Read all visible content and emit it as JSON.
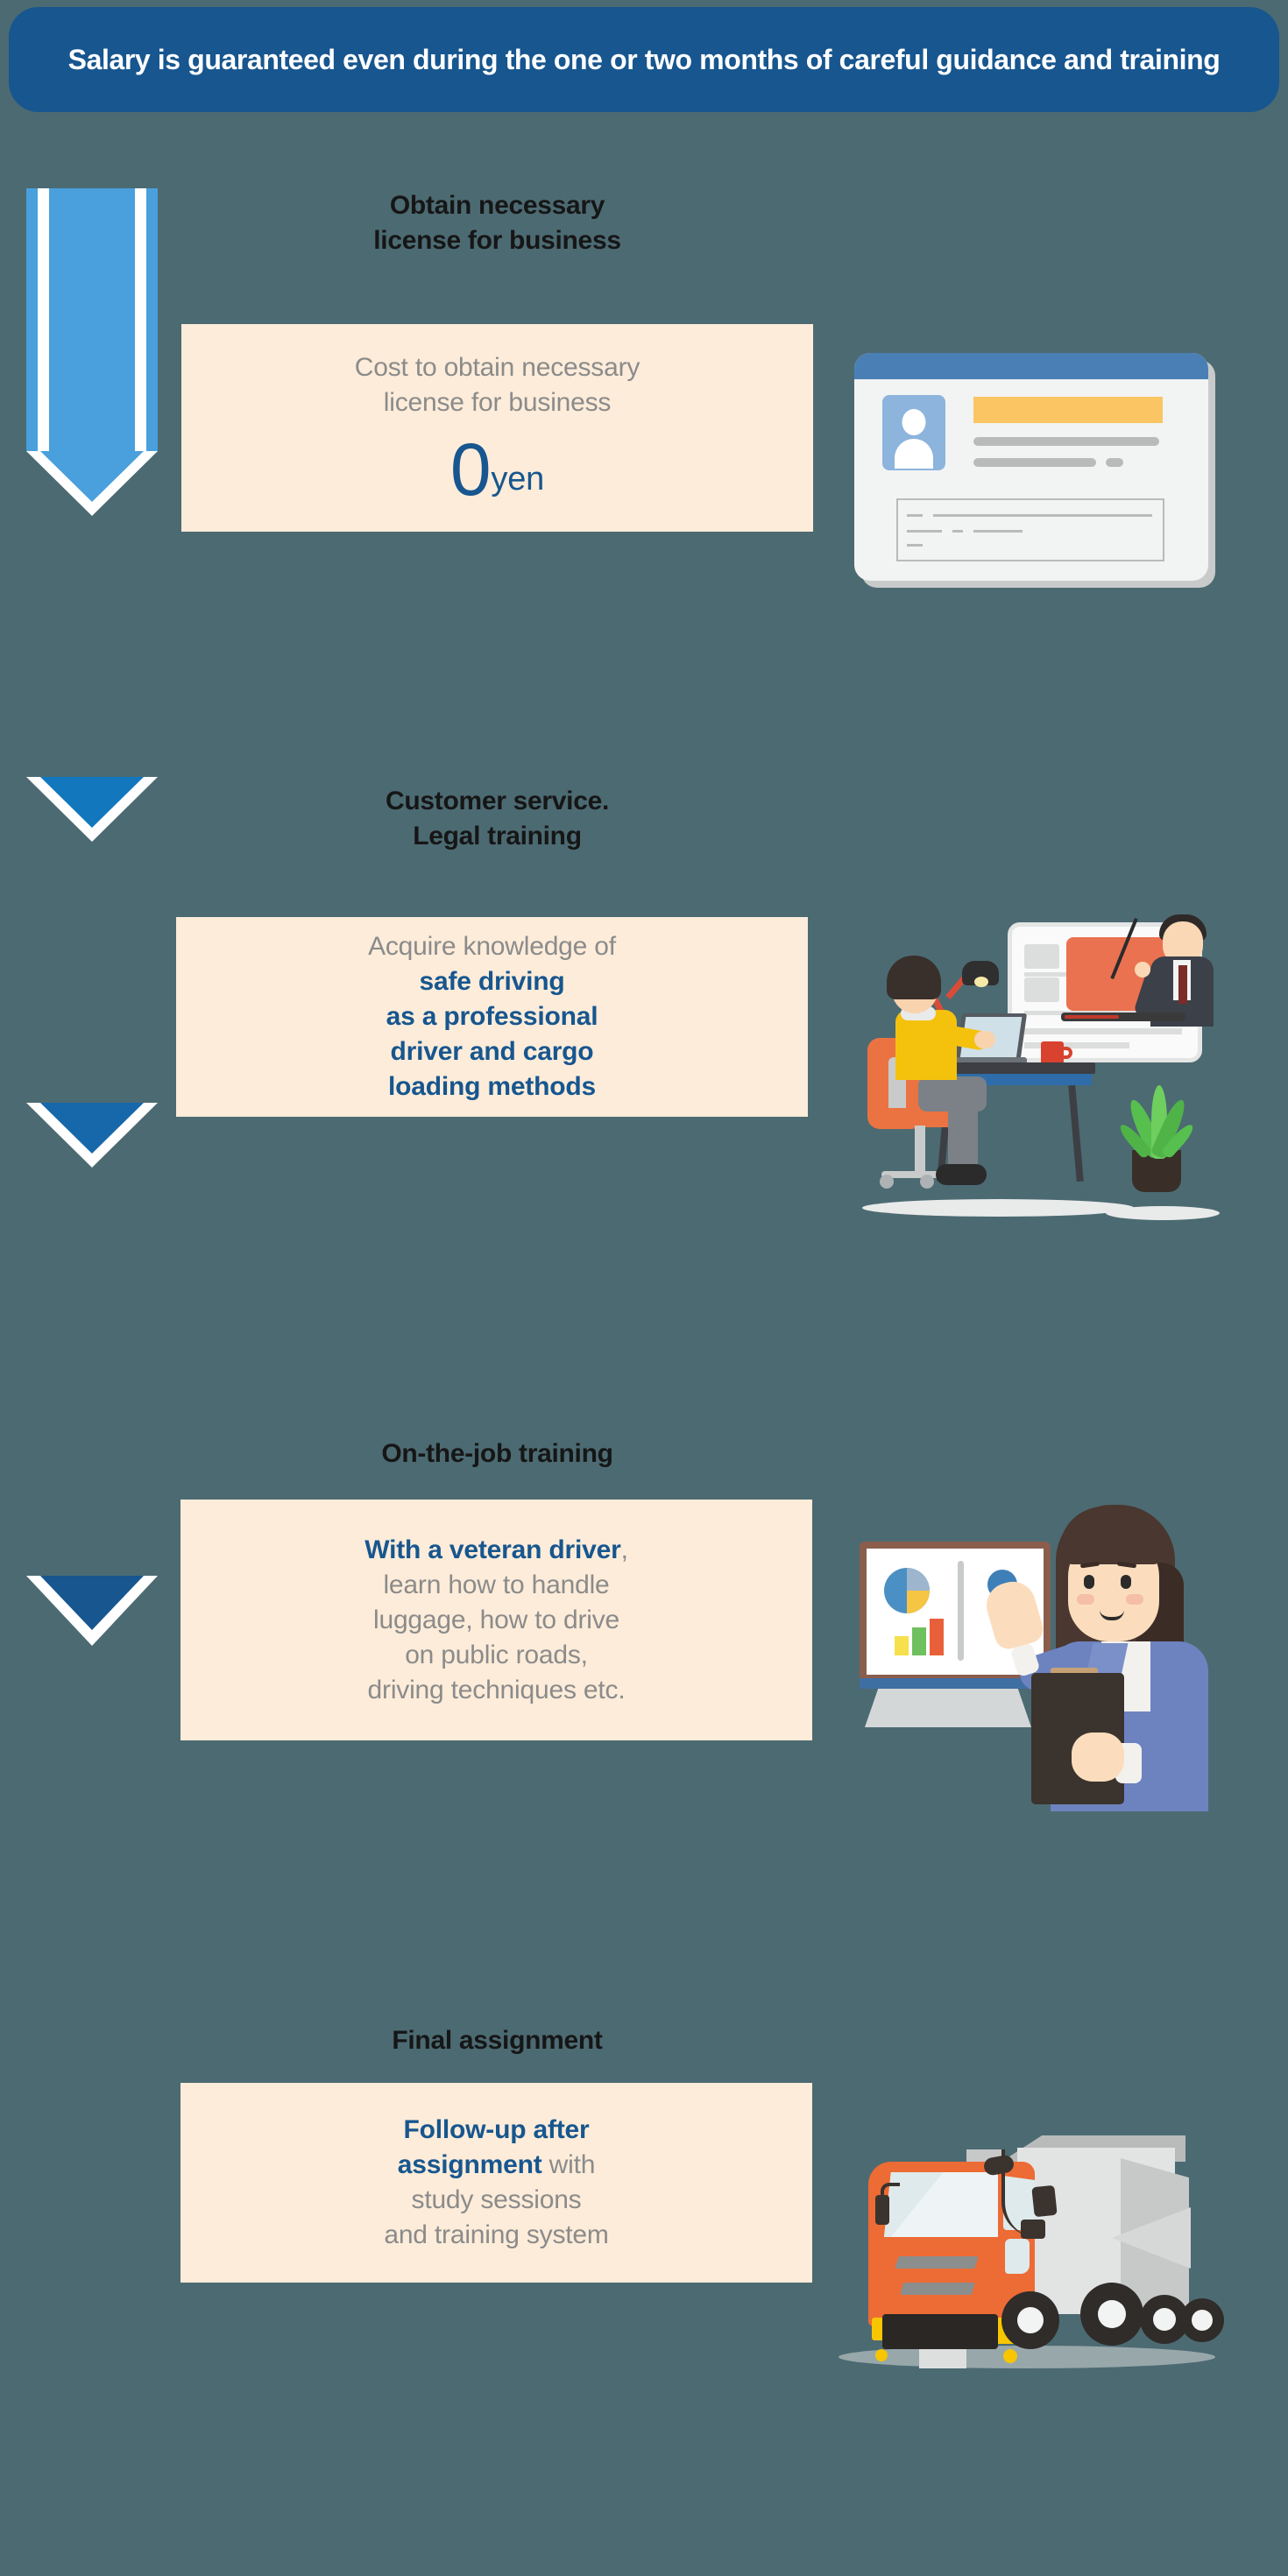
{
  "banner": {
    "text": "Salary is guaranteed even during the one or two months of careful guidance and training",
    "bg_color": "#17568f",
    "text_color": "#ffffff"
  },
  "page": {
    "background_color": "#4c6a72",
    "card_background_color": "#fcecd9",
    "accent_blue": "#17568f",
    "body_gray": "#8b8b8b"
  },
  "steps": [
    {
      "title_line1": "Obtain necessary",
      "title_line2": "license for business",
      "body_line1": "Cost to obtain necessary",
      "body_line2": "license for business",
      "amount_number": "0",
      "amount_unit": "yen",
      "illustration": "id-card-illustration",
      "arrow_color": "#49a0dd"
    },
    {
      "title_line1": "Customer service.",
      "title_line2": "Legal training",
      "body_gray_line": "Acquire knowledge of",
      "body_blue_line1": "safe driving",
      "body_blue_line2": "as a professional",
      "body_blue_line3": "driver and cargo",
      "body_blue_line4": "loading methods",
      "illustration": "online-training-illustration",
      "arrow_color": "#1277bd"
    },
    {
      "title_line1": "On-the-job training",
      "title_line2": "",
      "body_blue_lead": "With a veteran driver",
      "body_gray_rest1": ",",
      "body_gray_line2": "learn how to handle",
      "body_gray_line3": "luggage, how to drive",
      "body_gray_line4": "on public roads,",
      "body_gray_line5": "driving techniques etc.",
      "illustration": "presenter-whiteboard-illustration",
      "arrow_color": "#1668ab"
    },
    {
      "title_line1": "Final assignment",
      "title_line2": "",
      "body_blue_line1": "Follow-up after",
      "body_blue_line2": "assignment",
      "body_gray_tail": " with",
      "body_gray_line3": "study sessions",
      "body_gray_line4": "and training system",
      "illustration": "delivery-truck-illustration",
      "arrow_color": "#17568f"
    }
  ]
}
